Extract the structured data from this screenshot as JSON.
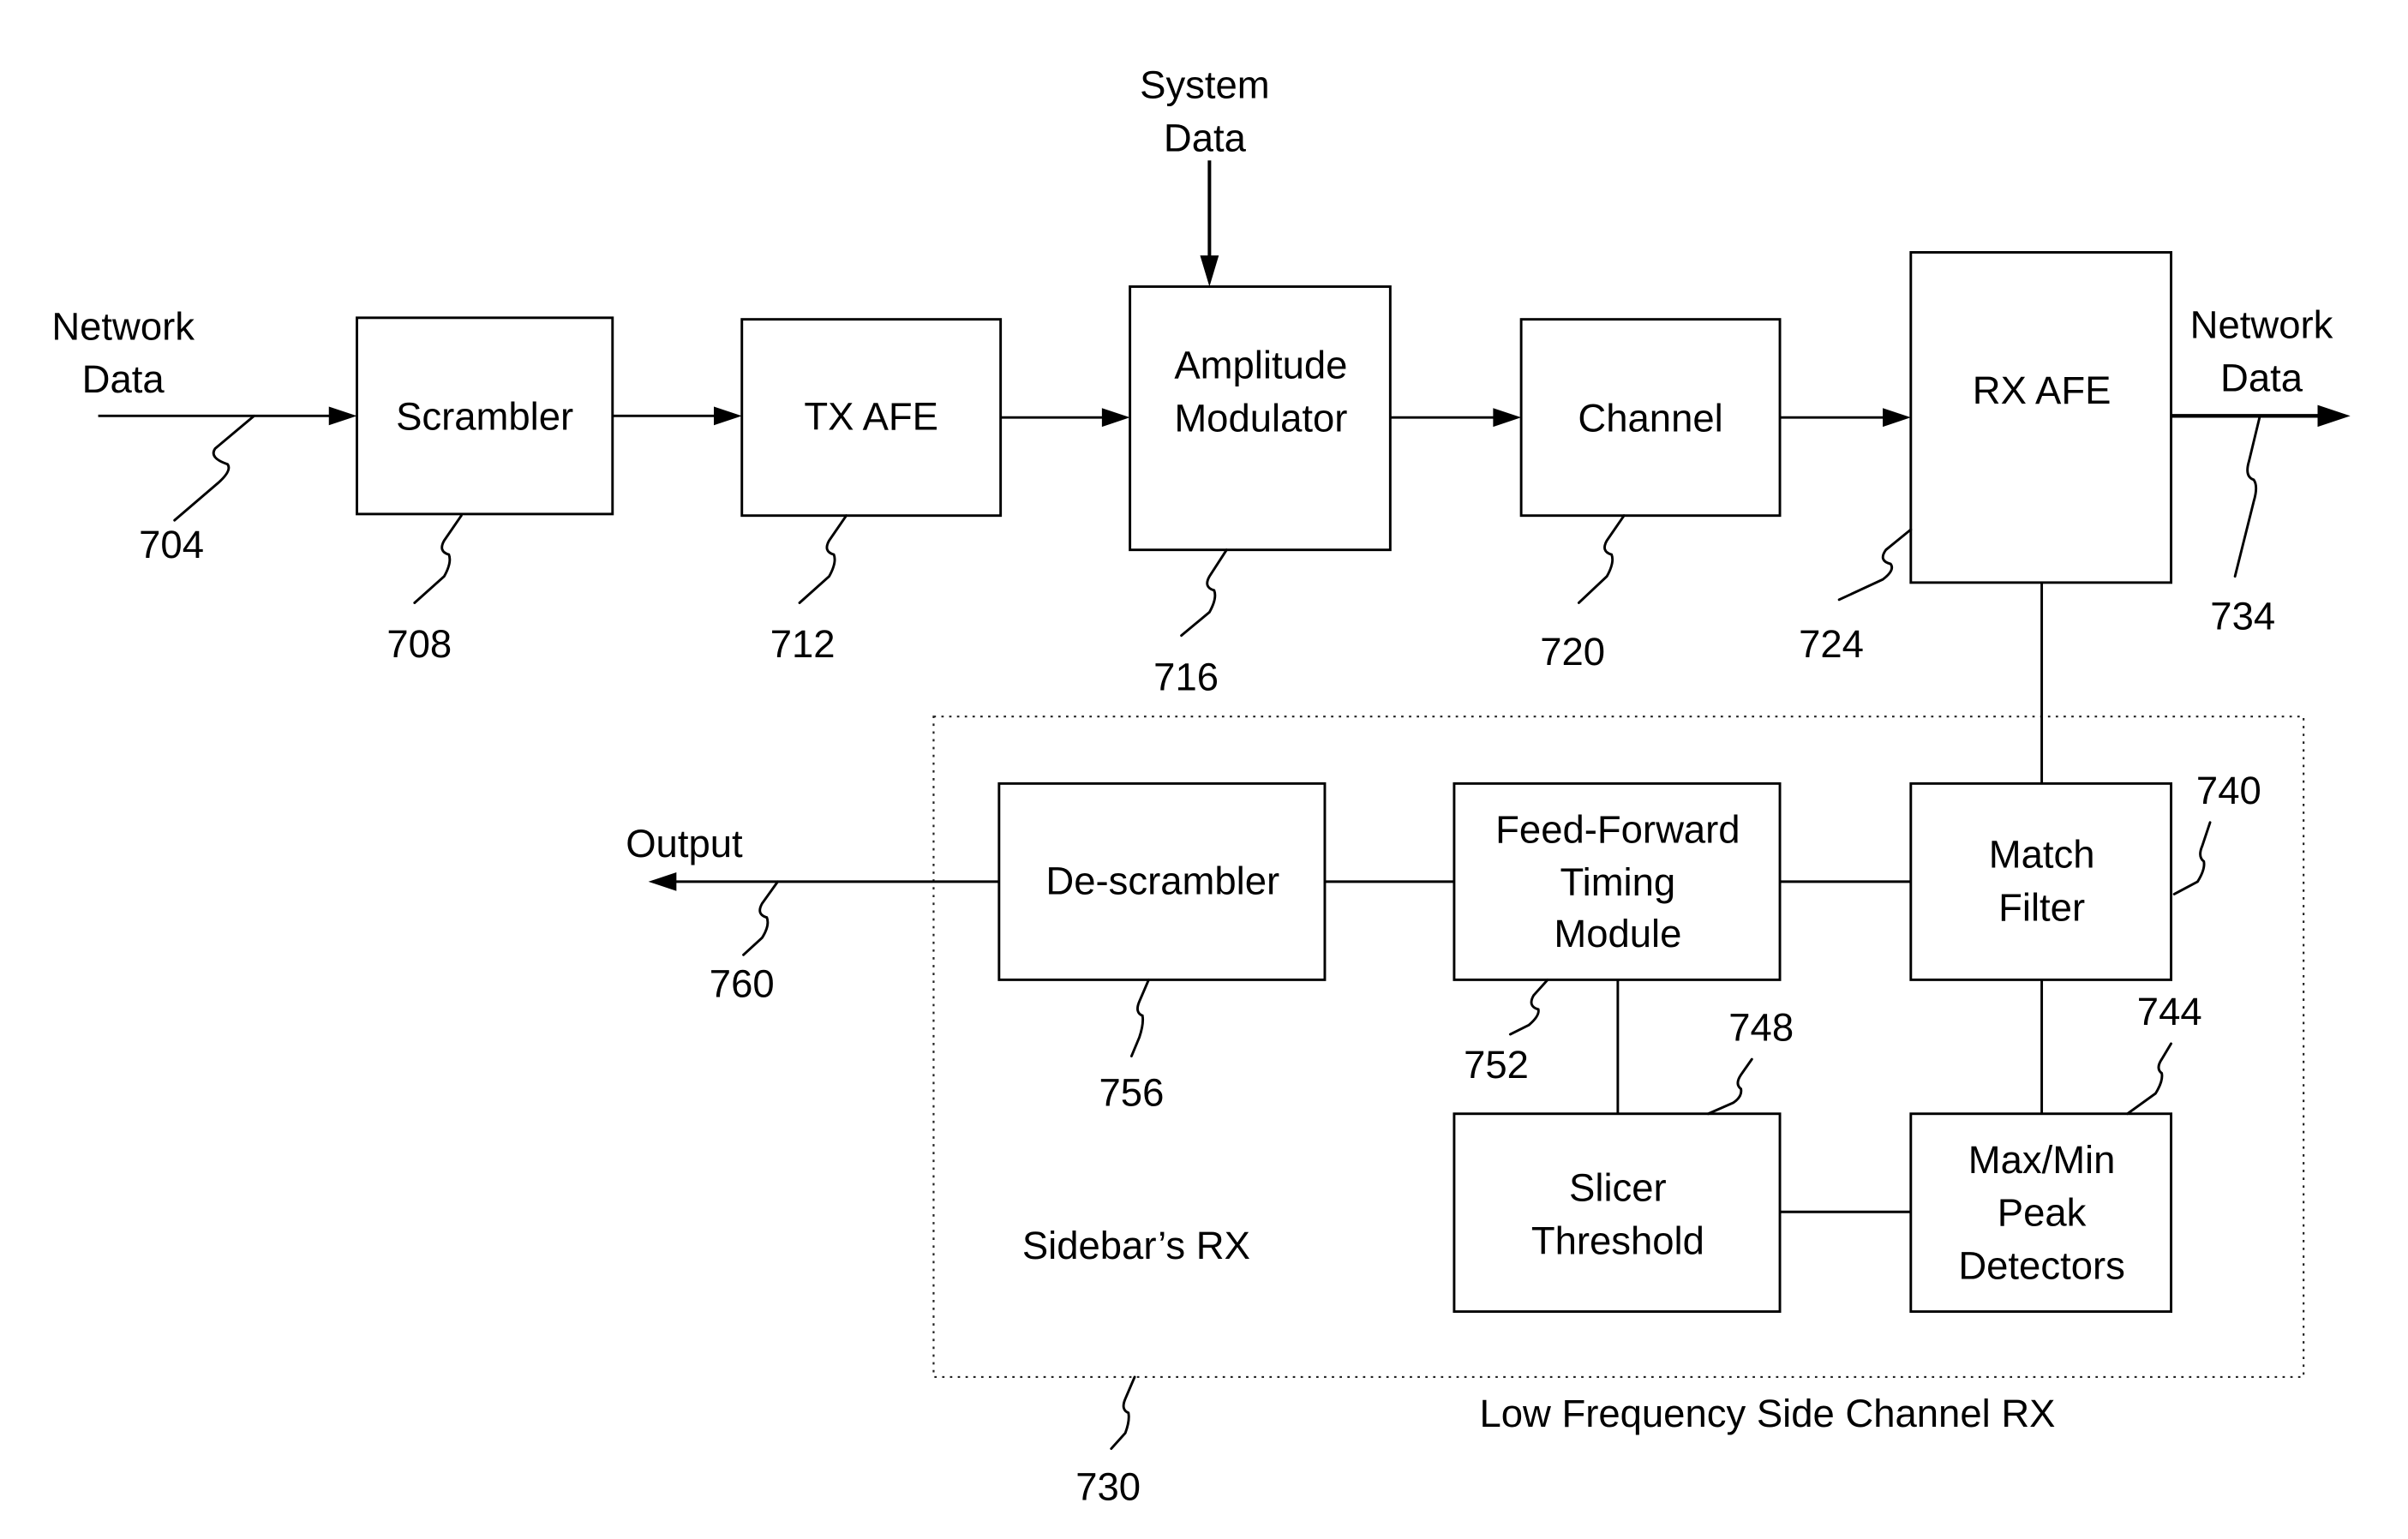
{
  "figure": {
    "type": "block-diagram",
    "background": "#ffffff",
    "ink": "#000000"
  },
  "inputs": {
    "network_data_in": [
      "Network",
      "Data"
    ],
    "system_data": [
      "System",
      "Data"
    ]
  },
  "outputs": {
    "network_data_out": [
      "Network",
      "Data"
    ],
    "output": "Output"
  },
  "blocks": {
    "scrambler": {
      "label": [
        "Scrambler"
      ],
      "ref": "708"
    },
    "tx_afe": {
      "label": [
        "TX AFE"
      ],
      "ref": "712"
    },
    "amplitude_modulator": {
      "label": [
        "Amplitude",
        "Modulator"
      ],
      "ref": "716"
    },
    "channel": {
      "label": [
        "Channel"
      ],
      "ref": "720"
    },
    "rx_afe": {
      "label": [
        "RX AFE"
      ],
      "ref": "724"
    },
    "match_filter": {
      "label": [
        "Match",
        "Filter"
      ],
      "ref": "740"
    },
    "peak_detectors": {
      "label": [
        "Max/Min",
        "Peak",
        "Detectors"
      ],
      "ref": "744"
    },
    "slicer_threshold": {
      "label": [
        "Slicer",
        "Threshold"
      ],
      "ref": "748"
    },
    "feed_forward_timing": {
      "label": [
        "Feed-Forward",
        "Timing",
        "Module"
      ],
      "ref": "752"
    },
    "descrambler": {
      "label": [
        "De-scrambler"
      ],
      "ref": "756"
    }
  },
  "signals": {
    "network_data_in_ref": "704",
    "network_data_out_ref": "734",
    "output_ref": "760"
  },
  "group": {
    "label": "Low Frequency Side Channel RX",
    "inner_label": "Sidebar’s RX",
    "ref": "730"
  }
}
